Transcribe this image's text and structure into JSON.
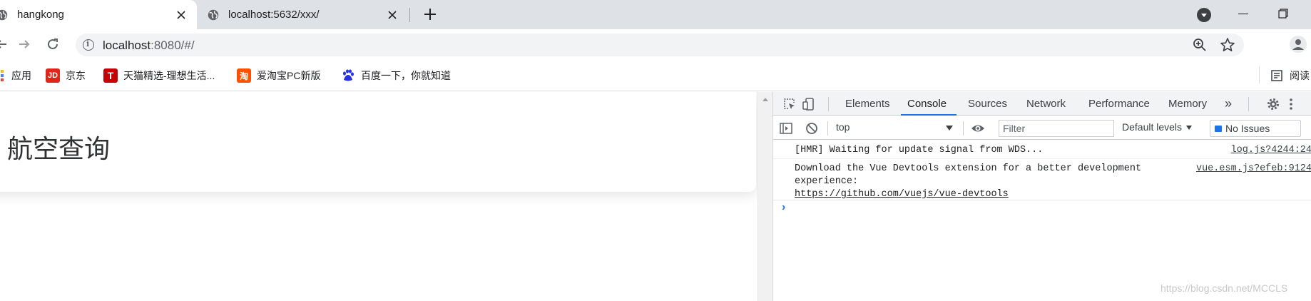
{
  "browser": {
    "tabs": [
      {
        "title": "hangkong",
        "active": true
      },
      {
        "title": "localhost:5632/xxx/",
        "active": false
      }
    ],
    "address": {
      "host": "localhost",
      "path": ":8080/#/"
    }
  },
  "bookmarks": [
    {
      "label": "应用",
      "icon": "apps-grid-icon"
    },
    {
      "label": "京东",
      "icon": "jd-icon",
      "icon_text": "JD",
      "color": "#e1251b"
    },
    {
      "label": "天猫精选-理想生活...",
      "icon": "tmall-icon",
      "icon_text": "T",
      "color": "#c40000"
    },
    {
      "label": "爱淘宝PC新版",
      "icon": "taobao-icon",
      "icon_text": "淘",
      "color": "#ff5000"
    },
    {
      "label": "百度一下，你就知道",
      "icon": "baidu-paw-icon",
      "color": "#2932e1"
    },
    {
      "label": "阅读",
      "icon": "reading-list-icon"
    }
  ],
  "page": {
    "heading": "航空查询"
  },
  "devtools": {
    "tabs": [
      "Elements",
      "Console",
      "Sources",
      "Network",
      "Performance",
      "Memory"
    ],
    "active_tab": "Console",
    "more_tabs": "»",
    "context": "top",
    "filter_placeholder": "Filter",
    "levels": "Default levels",
    "issues": "No Issues",
    "messages": [
      {
        "text": "[HMR] Waiting for update signal from WDS...",
        "source": "log.js?4244:24"
      },
      {
        "text": "Download the Vue Devtools extension for a better development\nexperience:",
        "link": "https://github.com/vuejs/vue-devtools",
        "source": "vue.esm.js?efeb:9124"
      }
    ],
    "prompt": "›"
  },
  "watermark": "https://blog.csdn.net/MCCLS",
  "colors": {
    "accent": "#1a73e8",
    "tabstrip": "#dee1e6"
  }
}
